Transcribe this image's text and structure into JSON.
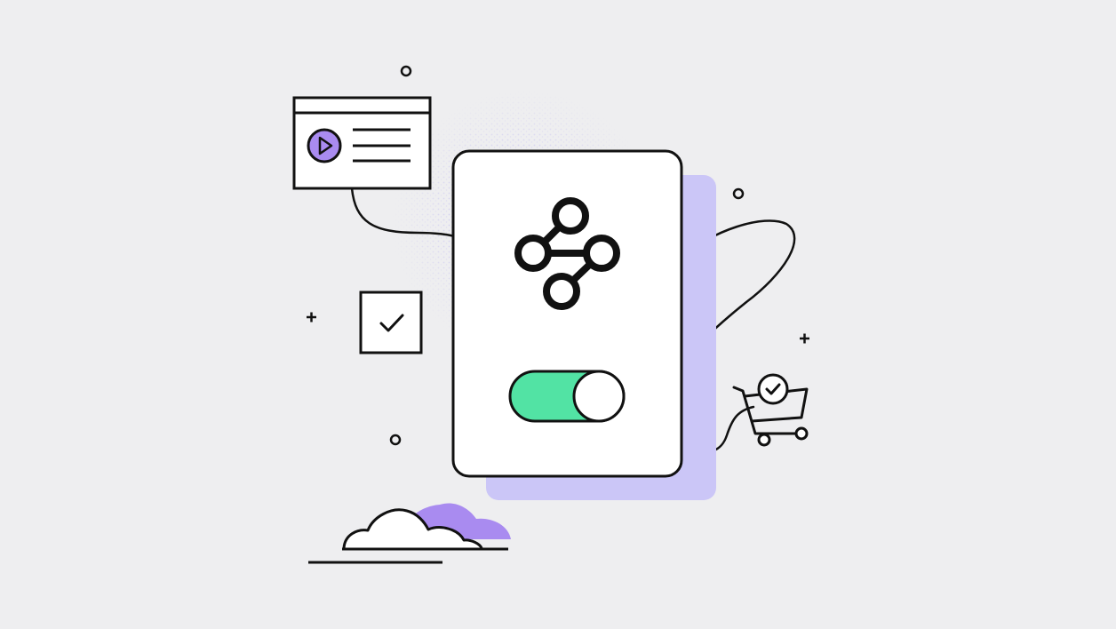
{
  "illustration": {
    "main_card": {
      "icon": "node-graph-icon",
      "toggle": {
        "state": "on"
      }
    },
    "video_window": {
      "icon": "play-icon"
    },
    "checkbox": {
      "checked": true,
      "icon": "checkmark-icon"
    },
    "shopping_cart": {
      "icon": "cart-check-icon"
    },
    "cloud": {
      "icon": "cloud-icon"
    },
    "colors": {
      "background": "#eeeef0",
      "accent_purple": "#a98bf0",
      "shadow_lavender": "#cbc6f7",
      "toggle_green": "#52e3a4",
      "stroke": "#111111",
      "card_fill": "#ffffff"
    }
  }
}
